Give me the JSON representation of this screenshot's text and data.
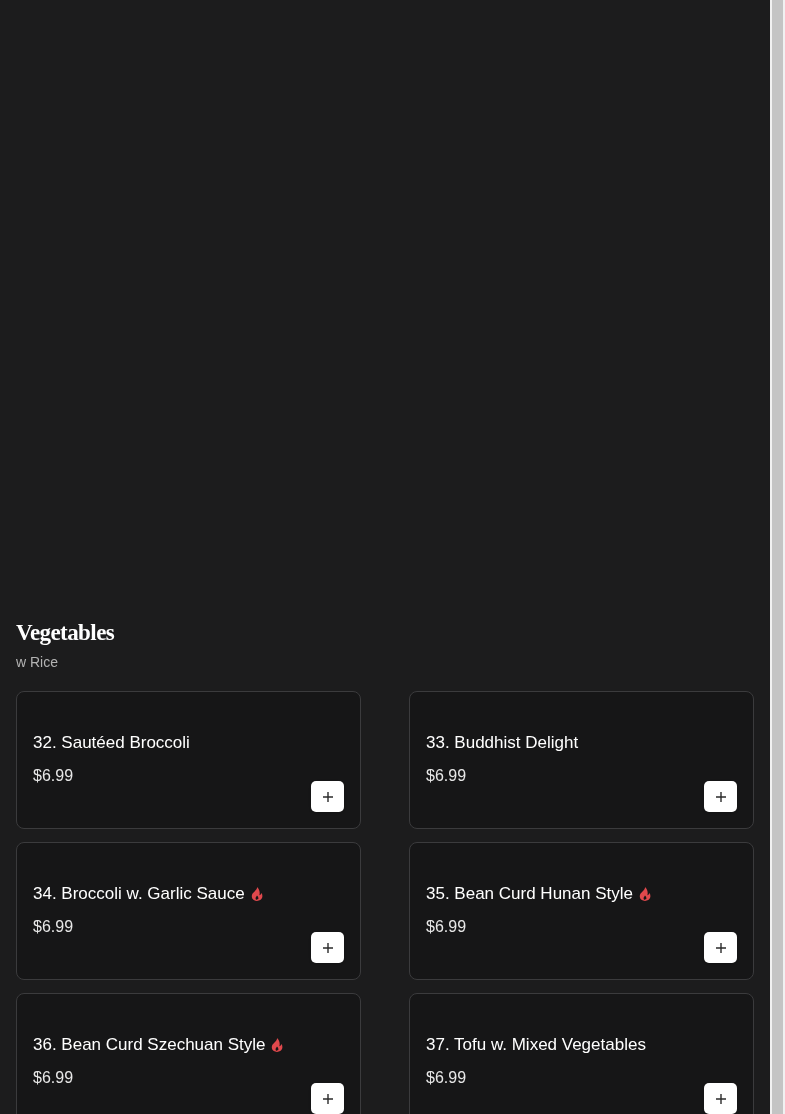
{
  "section": {
    "title": "Vegetables",
    "subtitle": "w Rice"
  },
  "items": [
    {
      "name": "32. Sautéed Broccoli",
      "price": "$6.99",
      "spicy": false
    },
    {
      "name": "33. Buddhist Delight",
      "price": "$6.99",
      "spicy": false
    },
    {
      "name": "34. Broccoli w. Garlic Sauce",
      "price": "$6.99",
      "spicy": true
    },
    {
      "name": "35. Bean Curd Hunan Style",
      "price": "$6.99",
      "spicy": true
    },
    {
      "name": "36. Bean Curd Szechuan Style",
      "price": "$6.99",
      "spicy": true
    },
    {
      "name": "37. Tofu w. Mixed Vegetables",
      "price": "$6.99",
      "spicy": false
    }
  ]
}
